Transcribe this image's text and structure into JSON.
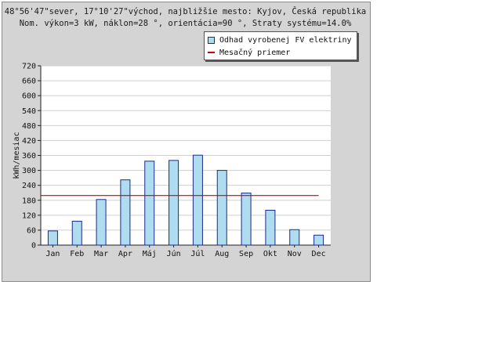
{
  "header": {
    "line1": "48°56'47\"sever, 17°10'27\"východ, najbližšie mesto: Kyjov, Česká republika",
    "line2": "Nom. výkon=3 kW, náklon=28 °, orientácia=90 °, Straty systému=14.0%"
  },
  "legend": {
    "bars_label": "Odhad vyrobenej FV elektriny",
    "avg_label": "Mesačný priemer"
  },
  "colors": {
    "bar_fill": "#b0dcf0",
    "bar_stroke": "#1a2a8a",
    "avg_line": "#d40000",
    "grid": "#cfcfcf",
    "plot_bg": "#ffffff"
  },
  "chart_data": {
    "type": "bar",
    "categories": [
      "Jan",
      "Feb",
      "Mar",
      "Apr",
      "Máj",
      "Jún",
      "Júl",
      "Aug",
      "Sep",
      "Okt",
      "Nov",
      "Dec"
    ],
    "series": [
      {
        "name": "Odhad vyrobenej FV elektriny",
        "values": [
          57,
          96,
          183,
          262,
          337,
          340,
          361,
          300,
          209,
          140,
          62,
          40
        ]
      }
    ],
    "average": {
      "name": "Mesačný priemer",
      "value": 199
    },
    "ylabel": "kWh/mesiac",
    "xlabel": "",
    "ylim": [
      0,
      720
    ],
    "yticks": [
      0,
      60,
      120,
      180,
      240,
      300,
      360,
      420,
      480,
      540,
      600,
      660,
      720
    ],
    "grid": true,
    "legend_position": "top-right"
  }
}
